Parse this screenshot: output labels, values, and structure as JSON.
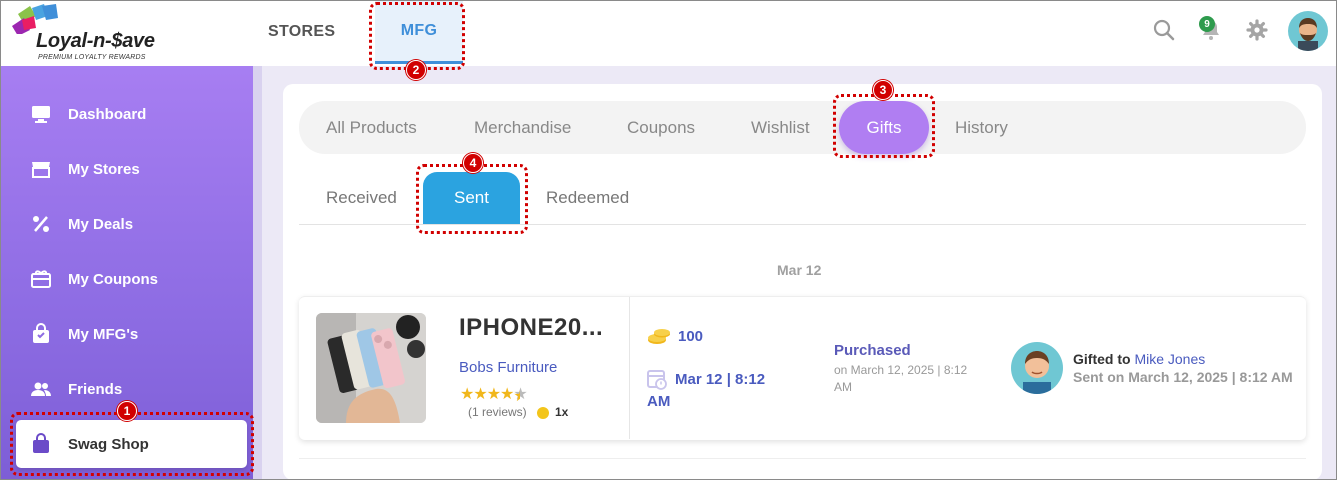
{
  "header": {
    "logo_text": "Loyal-n-$ave",
    "logo_tagline": "PREMIUM LOYALTY REWARDS",
    "tabs": [
      {
        "label": "STORES"
      },
      {
        "label": "MFG"
      }
    ],
    "notification_count": "9"
  },
  "sidebar": {
    "items": [
      {
        "label": "Dashboard",
        "icon": "monitor-icon"
      },
      {
        "label": "My Stores",
        "icon": "store-icon"
      },
      {
        "label": "My Deals",
        "icon": "percent-icon"
      },
      {
        "label": "My Coupons",
        "icon": "coupon-icon"
      },
      {
        "label": "My MFG's",
        "icon": "shopping-bag-icon"
      },
      {
        "label": "Friends",
        "icon": "friends-icon"
      },
      {
        "label": "Swag Shop",
        "icon": "bag-icon"
      }
    ]
  },
  "main": {
    "category_tabs": [
      "All Products",
      "Merchandise",
      "Coupons",
      "Wishlist",
      "Gifts",
      "History"
    ],
    "gift_tabs": [
      "Received",
      "Sent",
      "Redeemed"
    ],
    "date_group": "Mar 12",
    "gift": {
      "title": "IPHONE20...",
      "store": "Bobs Furniture",
      "rating": 4.5,
      "reviews": "(1 reviews)",
      "multiplier": "1x",
      "points": "100",
      "date": "Mar 12 | 8:12 AM",
      "status": "Purchased",
      "status_detail": "on March 12, 2025 | 8:12 AM",
      "gifted_to_prefix": "Gifted to",
      "recipient": "Mike Jones",
      "sent_on": "Sent on March 12, 2025 | 8:12 AM"
    }
  },
  "callouts": [
    "1",
    "2",
    "3",
    "4"
  ],
  "colors": {
    "sidebar_gradient_top": "#a77ef2",
    "accent_blue": "#2ba3e0",
    "gifts_purple": "#b07ef2",
    "link_blue": "#4a5bbf",
    "callout_red": "#d10000"
  }
}
